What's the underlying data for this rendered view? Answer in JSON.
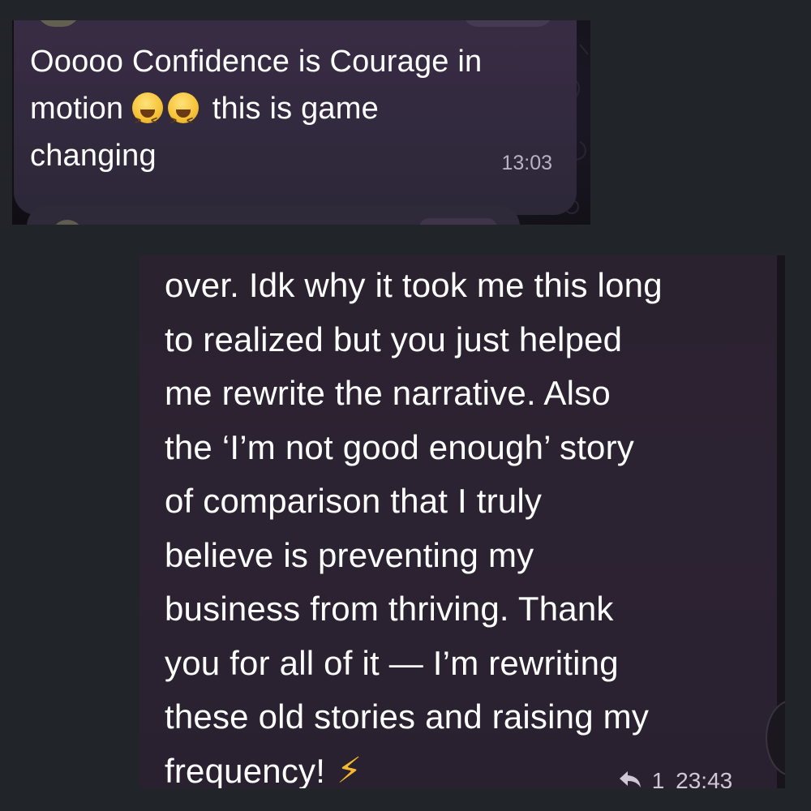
{
  "top_message": {
    "line1": "Ooooo Confidence is Courage in",
    "line2_before": "motion",
    "line2_after": "this is game",
    "line3": "changing",
    "emoji_name": "grinning-squinting-face-icon",
    "time": "13:03"
  },
  "bottom_message": {
    "lines": [
      "over. Idk why it took me this long",
      "to realized but you just helped",
      "me rewrite the narrative. Also",
      "the ‘I’m not good enough’ story",
      "of comparison that I truly",
      "believe is preventing my",
      "business from thriving. Thank",
      "you for all of it — I’m rewriting",
      "these old stories and raising my"
    ],
    "last_line": "frequency!",
    "emoji": "⚡",
    "reply_count": "1",
    "time": "23:43"
  },
  "colors": {
    "page_background": "#212428",
    "bubble_top": "#3a2d45",
    "bubble_bottom": "#2b2230",
    "text": "#ffffff",
    "timestamp": "#b9b2c4",
    "lightning": "#f5b82e"
  }
}
